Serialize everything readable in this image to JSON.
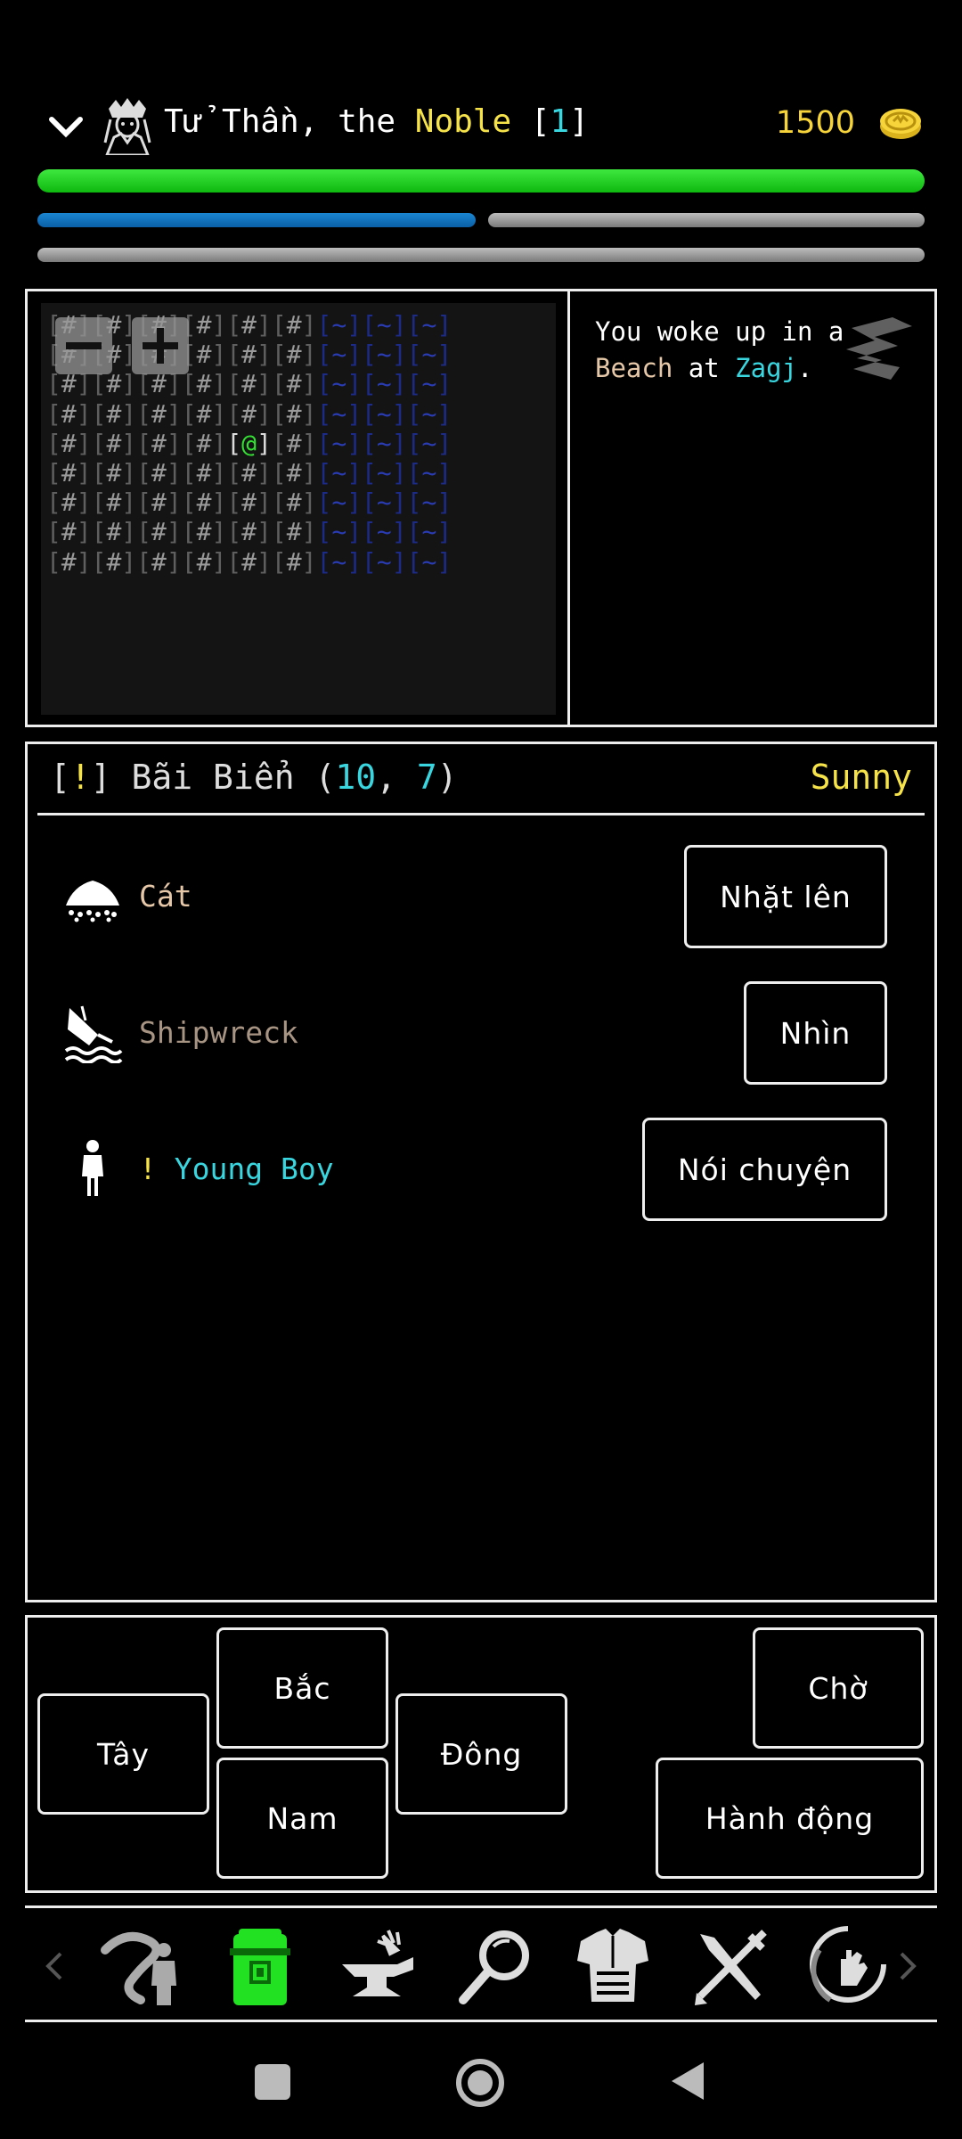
{
  "header": {
    "name": "Tử Thần",
    "name_sep": ", the ",
    "title": "Noble",
    "level_open": " [",
    "level": "1",
    "level_close": "]",
    "gold": "1500"
  },
  "colors": {
    "hp": "#22cc22",
    "mp": "#1173c0",
    "gold": "#f6d43a",
    "accent_cyan": "#39d6e0",
    "accent_yellow": "#f6e34a"
  },
  "map": {
    "rows": [
      "[#][#][#][#][#][#][~][~][~]",
      "[#][#][#][#][#][#][~][~][~]",
      "[#][#][#][#][#][#][~][~][~]",
      "[#][#][#][#][#][#][~][~][~]",
      "[#][#][#][#][@][#][~][~][~]",
      "[#][#][#][#][#][#][~][~][~]",
      "[#][#][#][#][#][#][~][~][~]",
      "[#][#][#][#][#][#][~][~][~]",
      "[#][#][#][#][#][#][~][~][~]"
    ]
  },
  "log": {
    "line1": "You woke up in a",
    "place": "Beach",
    "at": " at ",
    "region": "Zagj",
    "end": "."
  },
  "location": {
    "marker_open": "[",
    "marker": "!",
    "marker_close": "]",
    "name": " Bãi Biển (",
    "x": "10",
    "comma": ", ",
    "y": "7",
    "close": ")",
    "weather": "Sunny"
  },
  "entities": [
    {
      "icon": "sand-pile-icon",
      "prefix": "",
      "label": "Cát",
      "action": "Nhặt lên"
    },
    {
      "icon": "shipwreck-icon",
      "prefix": "",
      "label": "Shipwreck",
      "action": "Nhìn"
    },
    {
      "icon": "person-icon",
      "prefix": "! ",
      "label": "Young Boy",
      "action": "Nói chuyện"
    }
  ],
  "movement": {
    "west": "Tây",
    "north": "Bắc",
    "south": "Nam",
    "east": "Đông",
    "wait": "Chờ",
    "act": "Hành động"
  },
  "tabs": [
    "travel-icon",
    "inventory-icon",
    "crafting-anvil-icon",
    "search-icon",
    "armor-icon",
    "weapons-tools-icon",
    "magic-hand-icon"
  ]
}
